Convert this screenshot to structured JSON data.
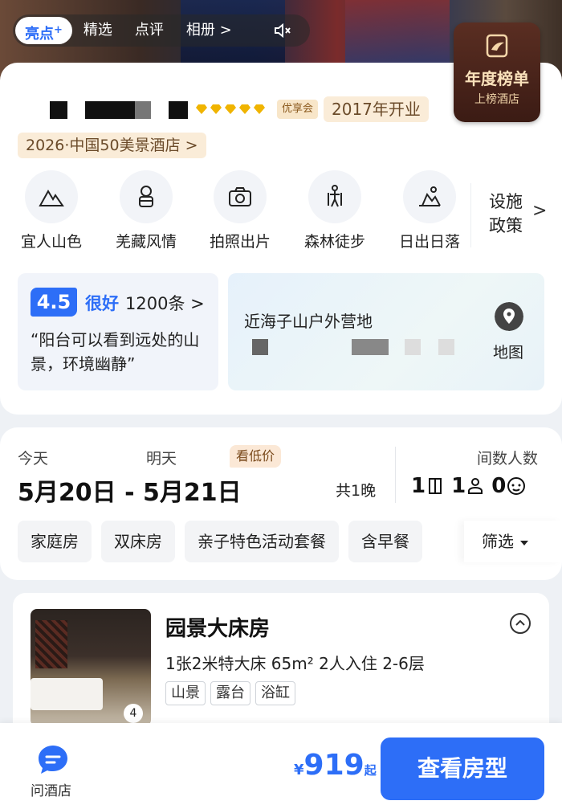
{
  "hero": {
    "tabs": [
      {
        "label": "亮点",
        "plus": "+",
        "active": true
      },
      {
        "label": "精选"
      },
      {
        "label": "点评"
      },
      {
        "label": "相册 >"
      }
    ],
    "mute_icon": "speaker-muted-icon"
  },
  "award": {
    "line1": "年度榜单",
    "line2": "上榜酒店"
  },
  "hotel": {
    "star_icon": "diamond-icon",
    "member_badge": "优享会",
    "opened": "2017年开业",
    "ranking": "2026·中国50美景酒店 >"
  },
  "features": [
    {
      "icon": "mountain-icon",
      "label": "宜人山色"
    },
    {
      "icon": "tibetan-figure-icon",
      "label": "羌藏风情"
    },
    {
      "icon": "camera-icon",
      "label": "拍照出片"
    },
    {
      "icon": "hiking-icon",
      "label": "森林徒步"
    },
    {
      "icon": "sunrise-icon",
      "label": "日出日落"
    }
  ],
  "policy": {
    "label": "设施政策",
    "chevron": ">"
  },
  "review": {
    "score": "4.5",
    "word": "很好",
    "count": "1200条 >",
    "quote": "“阳台可以看到远处的山景，环境幽静”"
  },
  "location": {
    "title": "近海子山户外营地",
    "map_label": "地图"
  },
  "dates": {
    "today_label": "今天",
    "tomorrow_label": "明天",
    "low_price_badge": "看低价",
    "range": "5月20日 - 5月21日",
    "nights": "共1晚",
    "guests_label": "间数人数",
    "rooms": "1",
    "adults": "1",
    "children": "0"
  },
  "filters": [
    "家庭房",
    "双床房",
    "亲子特色活动套餐",
    "含早餐"
  ],
  "filter_button": "筛选",
  "room": {
    "title": "园景大床房",
    "spec": "1张2米特大床  65m²  2人入住  2-6层",
    "tags": [
      "山景",
      "露台",
      "浴缸"
    ],
    "photo_count": "4"
  },
  "bottom": {
    "ask_label": "问酒店",
    "currency": "¥",
    "price": "919",
    "price_suffix": "起",
    "book_label": "查看房型"
  },
  "colors": {
    "accent": "#2d6ef7",
    "gold": "#f0b400"
  }
}
